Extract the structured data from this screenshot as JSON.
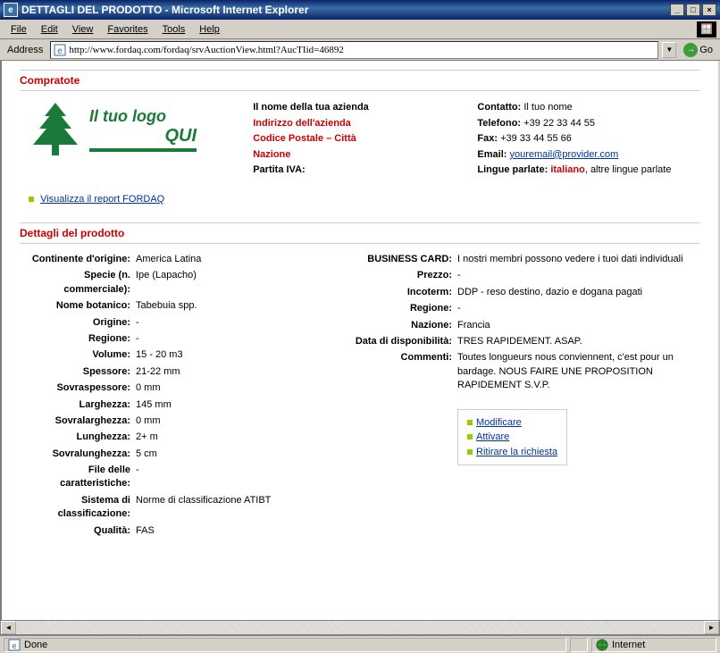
{
  "window": {
    "title": "DETTAGLI DEL PRODOTTO - Microsoft Internet Explorer"
  },
  "menubar": {
    "file": "File",
    "edit": "Edit",
    "view": "View",
    "favorites": "Favorites",
    "tools": "Tools",
    "help": "Help"
  },
  "addressbar": {
    "label": "Address",
    "url": "http://www.fordaq.com/fordaq/srvAuctionView.html?AucTIid=46892",
    "go": "Go"
  },
  "section_compratote": "Compratote",
  "logo": {
    "line1": "Il tuo logo",
    "line2": "QUI"
  },
  "report_link": "Visualizza il report FORDAQ",
  "company_info": {
    "name": "Il nome della tua azienda",
    "address": "Indirizzo dell'azienda",
    "postal": "Codice Postale – Città",
    "country": "Nazione",
    "vat_label": "Partita IVA:"
  },
  "contact": {
    "contact_label": "Contatto:",
    "contact_val": "Il tuo nome",
    "phone_label": "Telefono:",
    "phone_val": "+39 22 33 44 55",
    "fax_label": "Fax:",
    "fax_val": "+39 33 44 55 66",
    "email_label": "Email:",
    "email_val": "youremail@provider.com",
    "lang_label": "Lingue parlate:",
    "lang_main": "italiano",
    "lang_rest": ", altre lingue parlate"
  },
  "section_details": "Dettagli del prodotto",
  "details_left": {
    "continent_lbl": "Continente d'origine:",
    "continent_val": "America Latina",
    "species_lbl": "Specie (n. commerciale):",
    "species_val": "Ipe (Lapacho)",
    "botanical_lbl": "Nome botanico:",
    "botanical_val": "Tabebuia spp.",
    "origin_lbl": "Origine:",
    "origin_val": "-",
    "region_lbl": "Regione:",
    "region_val": "-",
    "volume_lbl": "Volume:",
    "volume_val": "15 - 20 m3",
    "thickness_lbl": "Spessore:",
    "thickness_val": "21-22 mm",
    "overthick_lbl": "Sovraspessore:",
    "overthick_val": "0 mm",
    "width_lbl": "Larghezza:",
    "width_val": "145 mm",
    "overwidth_lbl": "Sovralarghezza:",
    "overwidth_val": "0 mm",
    "length_lbl": "Lunghezza:",
    "length_val": "2+ m",
    "overlength_lbl": "Sovralunghezza:",
    "overlength_val": "5 cm",
    "file_lbl": "File delle caratteristiche:",
    "file_val": "-",
    "class_lbl": "Sistema di classificazione:",
    "class_val": "Norme di classificazione ATIBT",
    "quality_lbl": "Qualità:",
    "quality_val": "FAS"
  },
  "details_right": {
    "bcard_lbl": "BUSINESS CARD:",
    "bcard_val": "I nostri membri possono vedere i tuoi dati individuali",
    "price_lbl": "Prezzo:",
    "price_val": "-",
    "incoterm_lbl": "Incoterm:",
    "incoterm_val": "DDP - reso destino, dazio e dogana pagati",
    "region_lbl": "Regione:",
    "region_val": "-",
    "country_lbl": "Nazione:",
    "country_val": "Francia",
    "avail_lbl": "Data di disponibilità:",
    "avail_val": "TRES RAPIDEMENT. ASAP.",
    "comments_lbl": "Commenti:",
    "comments_val": "Toutes longueurs nous conviennent, c'est pour un bardage. NOUS FAIRE UNE PROPOSITION RAPIDEMENT S.V.P."
  },
  "actions": {
    "modify": "Modificare",
    "activate": "Attivare",
    "withdraw": "Ritirare la richiesta"
  },
  "statusbar": {
    "done": "Done",
    "zone": "Internet"
  }
}
